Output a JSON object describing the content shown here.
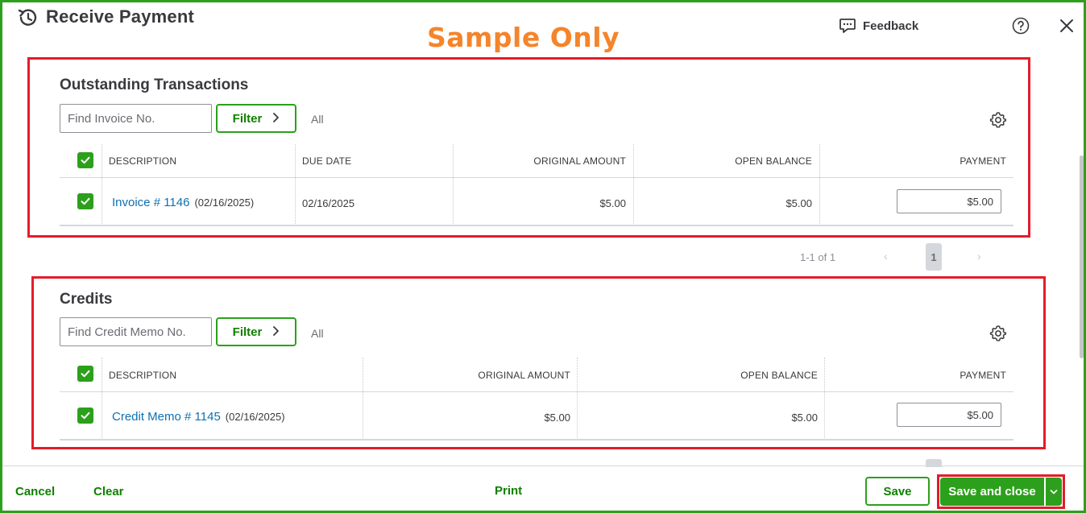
{
  "header": {
    "title": "Receive Payment",
    "watermark": "Sample Only",
    "feedback_label": "Feedback"
  },
  "outstanding": {
    "title": "Outstanding Transactions",
    "search_placeholder": "Find Invoice No.",
    "filter_label": "Filter",
    "filter_value": "All",
    "columns": [
      "DESCRIPTION",
      "DUE DATE",
      "ORIGINAL AMOUNT",
      "OPEN BALANCE",
      "PAYMENT"
    ],
    "rows": [
      {
        "description": "Invoice # 1146",
        "description_date": "(02/16/2025)",
        "due_date": "02/16/2025",
        "original_amount": "$5.00",
        "open_balance": "$5.00",
        "payment": "$5.00",
        "checked": true
      }
    ],
    "pagination": {
      "summary": "1-1 of 1",
      "prev": "‹",
      "page": "1",
      "next": "›"
    }
  },
  "credits": {
    "title": "Credits",
    "search_placeholder": "Find Credit Memo No.",
    "filter_label": "Filter",
    "filter_value": "All",
    "columns": [
      "DESCRIPTION",
      "ORIGINAL AMOUNT",
      "OPEN BALANCE",
      "PAYMENT"
    ],
    "rows": [
      {
        "description": "Credit Memo # 1145",
        "description_date": "(02/16/2025)",
        "original_amount": "$5.00",
        "open_balance": "$5.00",
        "payment": "$5.00",
        "checked": true
      }
    ]
  },
  "footer": {
    "cancel_label": "Cancel",
    "clear_label": "Clear",
    "print_label": "Print",
    "save_label": "Save",
    "save_close_label": "Save and close"
  },
  "colors": {
    "brand_green": "#2ca01c",
    "link_blue": "#0f6fb1",
    "highlight_red": "#e31c2a",
    "watermark_orange": "#f5842a"
  }
}
